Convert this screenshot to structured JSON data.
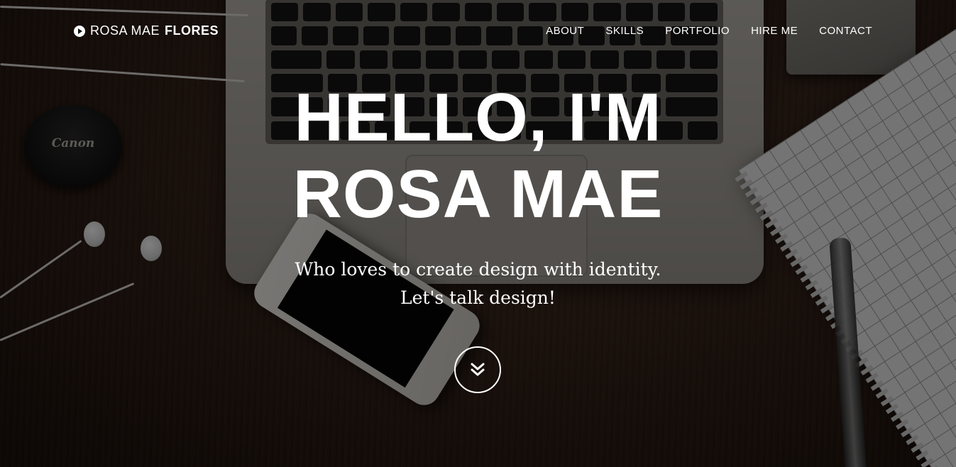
{
  "brand": {
    "first": "ROSA MAE",
    "last": "FLORES",
    "icon": "play-circle-icon"
  },
  "nav": {
    "items": [
      {
        "label": "ABOUT"
      },
      {
        "label": "SKILLS"
      },
      {
        "label": "PORTFOLIO"
      },
      {
        "label": "HIRE ME"
      },
      {
        "label": "CONTACT"
      }
    ]
  },
  "hero": {
    "line1": "HELLO, I'M",
    "line2": "ROSA MAE",
    "sub1": "Who loves to create design with identity.",
    "sub2": "Let's talk design!",
    "scroll_icon": "double-chevron-down-icon"
  },
  "background": {
    "lens_brand": "Canon"
  },
  "colors": {
    "text": "#ffffff",
    "overlay": "#000000",
    "desk": "#2f1e16"
  }
}
